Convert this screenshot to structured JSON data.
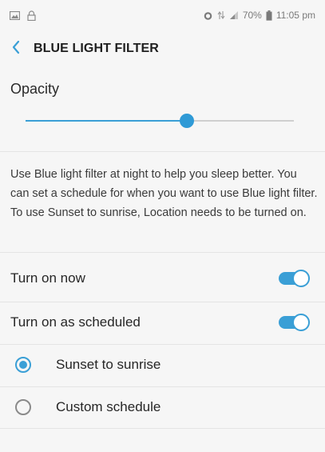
{
  "status_bar": {
    "battery_percent": "70%",
    "time": "11:05 pm",
    "left_icons": [
      "gallery-icon",
      "lock-icon"
    ],
    "right_icons": [
      "alarm-icon",
      "network-icon",
      "signal-icon",
      "battery-icon"
    ]
  },
  "app_bar": {
    "back_icon": "chevron-left-icon",
    "title": "BLUE LIGHT FILTER"
  },
  "opacity": {
    "label": "Opacity",
    "value_fraction": 0.6
  },
  "description": "Use Blue light filter at night to help you sleep better. You can set a schedule for when you want to use Blue light filter. To use Sunset to sunrise, Location needs to be turned on.",
  "settings": [
    {
      "label": "Turn on now",
      "enabled": true
    },
    {
      "label": "Turn on as scheduled",
      "enabled": true
    }
  ],
  "schedule_options": [
    {
      "label": "Sunset to sunrise",
      "selected": true
    },
    {
      "label": "Custom schedule",
      "selected": false
    }
  ],
  "colors": {
    "accent": "#3a9fd6",
    "background": "#f6f6f6",
    "divider": "#e4e4e4"
  }
}
